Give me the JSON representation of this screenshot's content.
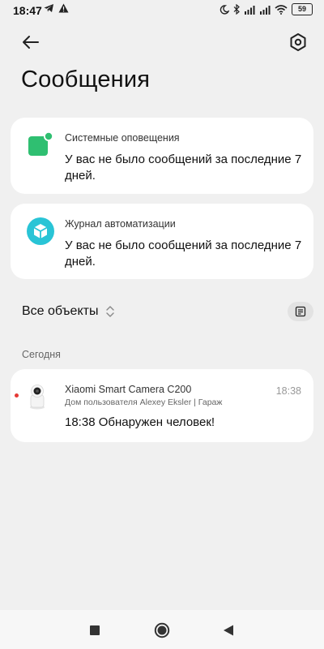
{
  "status_bar": {
    "time": "18:47",
    "battery": "59",
    "left_icons": [
      "telegram-icon",
      "alert-icon"
    ],
    "right_icons": [
      "moon-icon",
      "bluetooth-icon",
      "signal-icon",
      "signal-icon",
      "wifi-icon",
      "battery-icon"
    ]
  },
  "header": {
    "title": "Сообщения"
  },
  "cards": {
    "system": {
      "label": "Системные оповещения",
      "text": "У вас не было сообщений за последние 7 дней.",
      "icon_color": "#2fbf71"
    },
    "automation": {
      "label": "Журнал автоматизации",
      "text": "У вас не было сообщений за последние 7 дней.",
      "icon_color": "#29c4d6"
    }
  },
  "filter": {
    "label": "Все объекты"
  },
  "section": {
    "today_label": "Сегодня"
  },
  "events": [
    {
      "device": "Xiaomi Smart Camera C200",
      "location": "Дом пользователя Alexey Eksler | Гараж",
      "time": "18:38",
      "text": "18:38 Обнаружен человек!",
      "unread": true
    }
  ],
  "colors": {
    "background": "#f0f0f0",
    "card": "#ffffff",
    "unread_dot": "#e53935"
  }
}
